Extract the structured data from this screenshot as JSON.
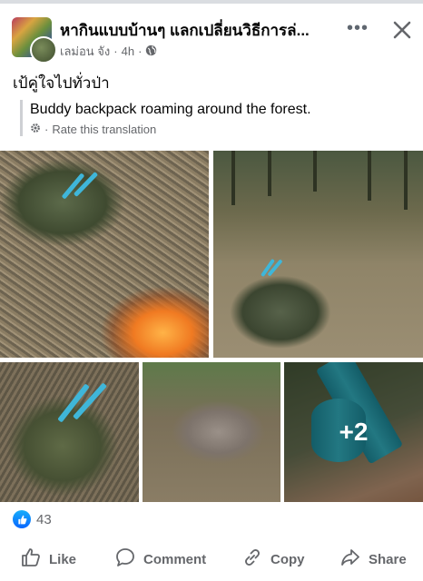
{
  "post": {
    "page_name": "หากินแบบบ้านๆ แลกเปลี่ยนวิธีการล่...",
    "author": "เลม่อน จัง",
    "time": "4h",
    "text": "เป้คู่ใจไปทั่วป่า",
    "translation": "Buddy backpack roaming around the forest.",
    "rate_translation": "Rate this translation",
    "more_photos": "+2"
  },
  "reactions": {
    "count": "43"
  },
  "actions": {
    "like": "Like",
    "comment": "Comment",
    "copy": "Copy",
    "share": "Share"
  },
  "icons": {
    "globe": "globe-icon",
    "more": "more-options-icon",
    "close": "close-icon",
    "gear": "gear-icon",
    "like_reaction": "like-reaction-icon",
    "like": "thumbs-up-icon",
    "comment": "comment-bubble-icon",
    "copy": "link-icon",
    "share": "share-arrow-icon"
  },
  "colors": {
    "like_blue": "#0866ff",
    "secondary_text": "#65676b"
  }
}
